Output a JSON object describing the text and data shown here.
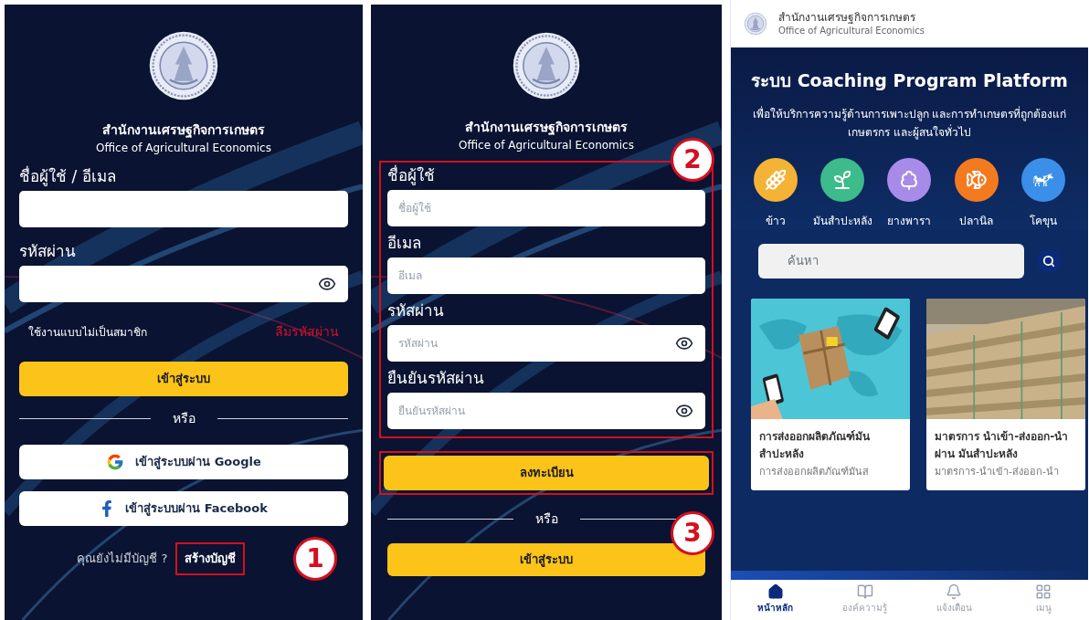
{
  "login_screen": {
    "org_name_th": "สำนักงานเศรษฐกิจการเกษตร",
    "org_name_en": "Office of Agricultural Economics",
    "fields": [
      {
        "label": "ชื่อผู้ใช้ / อีเมล",
        "kind": "text"
      },
      {
        "label": "รหัสผ่าน",
        "kind": "password"
      }
    ],
    "guest_link": "ใช้งานแบบไม่เป็นสมาชิก",
    "forgot_password_link": "ลืมรหัสผ่าน",
    "login_button": "เข้าสู่ระบบ",
    "divider_text": "หรือ",
    "google_button": "เข้าสู่ระบบผ่าน Google",
    "facebook_button": "เข้าสู่ระบบผ่าน Facebook",
    "no_account_text": "คุณยังไม่มีบัญชี ?",
    "create_account_link": "สร้างบัญชี",
    "marker": "1"
  },
  "register_screen": {
    "org_name_th": "สำนักงานเศรษฐกิจการเกษตร",
    "org_name_en": "Office of Agricultural Economics",
    "fields": [
      {
        "label": "ชื่อผู้ใช้",
        "placeholder": "ชื่อผู้ใช้",
        "kind": "text"
      },
      {
        "label": "อีเมล",
        "placeholder": "อีเมล",
        "kind": "text"
      },
      {
        "label": "รหัสผ่าน",
        "placeholder": "รหัสผ่าน",
        "kind": "password"
      },
      {
        "label": "ยืนยันรหัสผ่าน",
        "placeholder": "ยืนยันรหัสผ่าน",
        "kind": "password"
      }
    ],
    "form_marker": "2",
    "register_button": "ลงทะเบียน",
    "button_marker": "3",
    "divider_text": "หรือ",
    "login_button": "เข้าสู่ระบบ"
  },
  "home_screen": {
    "header": {
      "org_name_th": "สำนักงานเศรษฐกิจการเกษตร",
      "org_name_en": "Office of Agricultural Economics"
    },
    "title": "ระบบ Coaching Program Platform",
    "subtitle": "เพื่อให้บริการความรู้ด้านการเพาะปลูก และการทำเกษตรที่ถูกต้องแก่เกษตรกร และผู้สนใจทั่วไป",
    "categories": [
      {
        "label": "ข้าว",
        "color": "#f5b335"
      },
      {
        "label": "มันสำปะหลัง",
        "color": "#3dbb8a"
      },
      {
        "label": "ยางพารา",
        "color": "#a88be8"
      },
      {
        "label": "ปลานิล",
        "color": "#f47a20"
      },
      {
        "label": "โคขุน",
        "color": "#3b8fe8"
      }
    ],
    "search": {
      "placeholder": "ค้นหา"
    },
    "articles": [
      {
        "title": "การส่งออกผลิตภัณฑ์มันสำปะหลัง",
        "summary": "การส่งออกผลิตภัณฑ์มันส"
      },
      {
        "title": "มาตรการ นำเข้า-ส่งออก-นำผ่าน มันสำปะหลัง",
        "summary": "มาตรการ-นำเข้า-ส่งออก-นำ"
      }
    ],
    "nav": [
      {
        "label": "หน้าหลัก",
        "selected": true
      },
      {
        "label": "องค์ความรู้",
        "selected": false
      },
      {
        "label": "แจ้งเตือน",
        "selected": false
      },
      {
        "label": "เมนู",
        "selected": false
      }
    ]
  }
}
